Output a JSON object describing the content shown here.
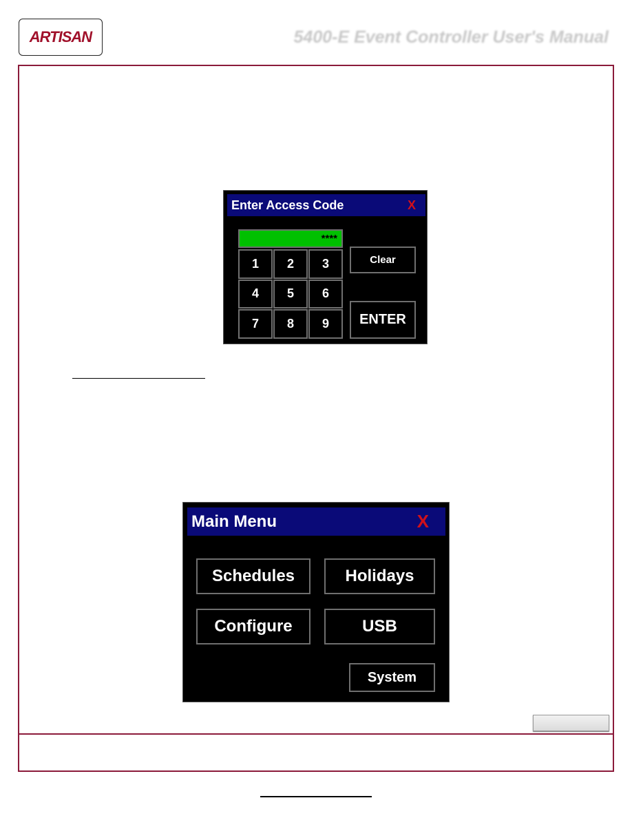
{
  "header": {
    "logo_text": "ARTISAN",
    "title": "5400-E Event Controller User's Manual"
  },
  "access_dialog": {
    "title": "Enter Access Code",
    "close": "X",
    "code_value": "****",
    "keys": [
      "1",
      "2",
      "3",
      "4",
      "5",
      "6",
      "7",
      "8",
      "9"
    ],
    "clear": "Clear",
    "enter": "ENTER",
    "field_color": "#00c000"
  },
  "main_menu": {
    "title": "Main Menu",
    "close": "X",
    "buttons": {
      "schedules": "Schedules",
      "holidays": "Holidays",
      "configure": "Configure",
      "usb": "USB",
      "system": "System"
    }
  },
  "colors": {
    "frame": "#8b1a3a",
    "titlebar": "#0a0a78",
    "close": "#d0101a"
  }
}
